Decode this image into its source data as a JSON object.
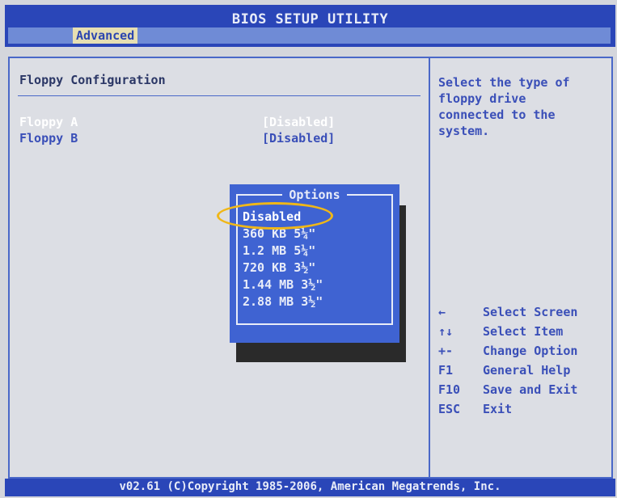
{
  "header": {
    "title": "BIOS SETUP UTILITY",
    "active_tab": "Advanced"
  },
  "main": {
    "section_title": "Floppy Configuration",
    "settings": [
      {
        "label": "Floppy A",
        "value": "[Disabled]"
      },
      {
        "label": "Floppy B",
        "value": "[Disabled]"
      }
    ]
  },
  "help": {
    "text": "Select the type of\nfloppy drive\nconnected to the\nsystem."
  },
  "popup": {
    "title": "Options",
    "options": [
      "Disabled",
      "360 KB 5¼\"",
      "1.2 MB 5¼\"",
      "720 KB 3½\"",
      "1.44 MB 3½\"",
      "2.88 MB 3½\""
    ],
    "selected": "Disabled"
  },
  "keys": [
    {
      "key": "←",
      "desc": "Select Screen"
    },
    {
      "key": "↑↓",
      "desc": "Select Item"
    },
    {
      "key": "+-",
      "desc": "Change Option"
    },
    {
      "key": "F1",
      "desc": "General Help"
    },
    {
      "key": "F10",
      "desc": "Save and Exit"
    },
    {
      "key": "ESC",
      "desc": "Exit"
    }
  ],
  "footer": {
    "copyright": "v02.61 (C)Copyright 1985-2006, American Megatrends, Inc."
  },
  "colors": {
    "bios_blue": "#2a46b8",
    "popup_blue": "#3f63d2",
    "highlight_ring": "#f0b718"
  }
}
